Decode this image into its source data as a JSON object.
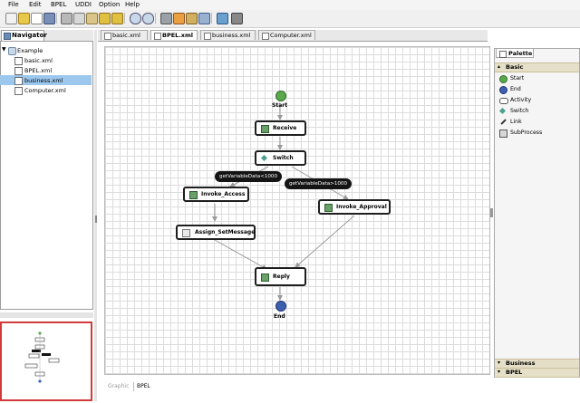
{
  "menu": [
    "File",
    "Edit",
    "BPEL",
    "UDDI",
    "Option",
    "Help"
  ],
  "navigator": {
    "tab_label": "Navigator",
    "root": "Example",
    "files": [
      "basic.xml",
      "BPEL.xml",
      "business.xml",
      "Computer.xml"
    ],
    "selected_index": 2
  },
  "editor": {
    "tabs": [
      "basic.xml",
      "BPEL.xml",
      "business.xml",
      "Computer.xml"
    ],
    "active_tab_index": 1,
    "bottom_tabs": [
      "Graphic",
      "BPEL"
    ],
    "active_bottom_tab_index": 1
  },
  "diagram": {
    "start_label": "Start",
    "end_label": "End",
    "nodes": {
      "receive": "Receive",
      "switch": "Switch",
      "invoke_access": "Invoke_Access",
      "invoke_approval": "Invoke_Approval",
      "assign": "Assign_SetMessage",
      "reply": "Reply"
    },
    "conditions": {
      "left": "getVariableData<1000",
      "right": "getVariableData>1000"
    }
  },
  "palette": {
    "tab_label": "Palette",
    "groups": [
      "Basic",
      "Business",
      "BPEL"
    ],
    "items": [
      "Start",
      "End",
      "Activity",
      "Switch",
      "Link",
      "SubProcess"
    ]
  },
  "colors": {
    "selection": "#9cc8ee",
    "outline_border": "#d23a3a",
    "palette_header": "#e6dfc8",
    "start_node": "#5aa84e",
    "end_node": "#3c5fb0"
  }
}
